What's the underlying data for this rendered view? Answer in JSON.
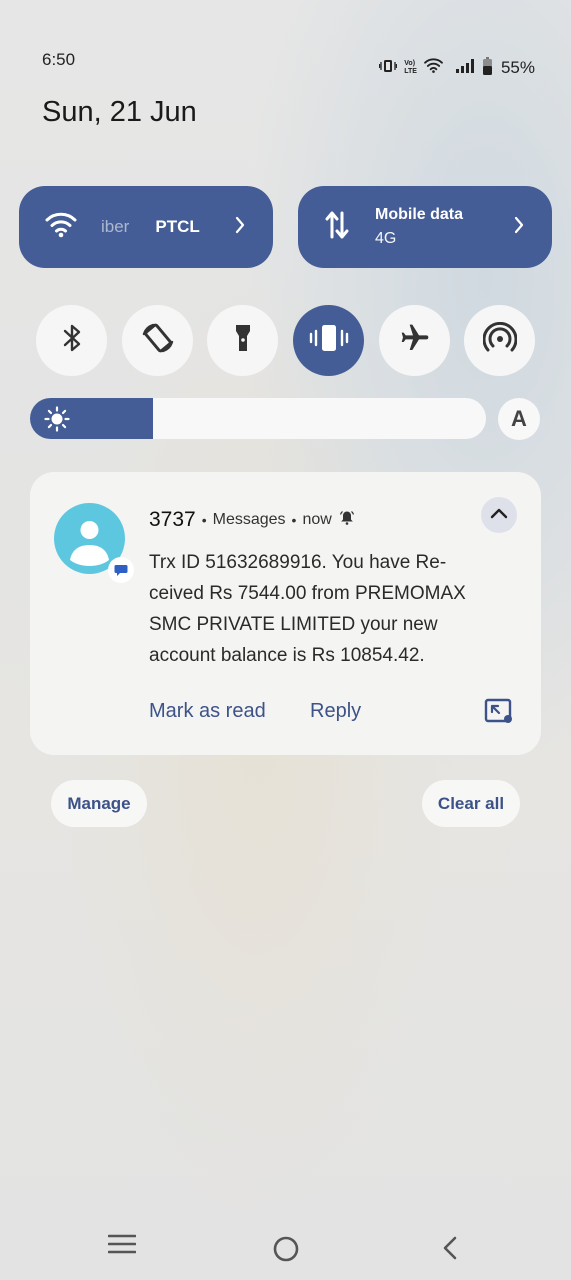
{
  "status_bar": {
    "time": "6:50",
    "battery_percent": "55%",
    "icons": [
      "vibrate-icon",
      "volte-icon",
      "wifi-icon",
      "signal-icon",
      "battery-icon"
    ],
    "volte_label_top": "Vo)",
    "volte_label_bottom": "LTE"
  },
  "date": "Sun, 21 Jun",
  "quick_tiles": {
    "wifi": {
      "ssid_faded": "iber",
      "ssid": "PTCL",
      "icon": "wifi-icon"
    },
    "mobile_data": {
      "title": "Mobile data",
      "subtitle": "4G",
      "icon": "data-arrows-icon"
    }
  },
  "toggles": [
    {
      "name": "bluetooth",
      "icon": "bluetooth-icon",
      "on": false
    },
    {
      "name": "auto-rotate",
      "icon": "rotate-icon",
      "on": false
    },
    {
      "name": "flashlight",
      "icon": "flashlight-icon",
      "on": false
    },
    {
      "name": "vibrate",
      "icon": "vibrate-icon",
      "on": true
    },
    {
      "name": "airplane-mode",
      "icon": "airplane-icon",
      "on": false
    },
    {
      "name": "hotspot",
      "icon": "hotspot-icon",
      "on": false
    }
  ],
  "brightness": {
    "level": 0.27,
    "auto_label": "A"
  },
  "notification": {
    "sender": "3737",
    "app": "Messages",
    "time": "now",
    "body": "Trx ID 51632689916. You have Re-ceived Rs 7544.00 from PREMOMAX SMC PRIVATE LIMITED your new account balance is Rs 10854.42.",
    "actions": {
      "mark_read": "Mark as read",
      "reply": "Reply"
    }
  },
  "buttons": {
    "manage": "Manage",
    "clear_all": "Clear all"
  },
  "colors": {
    "accent": "#455d96",
    "link": "#3d5288",
    "avatar": "#5ec7e0"
  }
}
